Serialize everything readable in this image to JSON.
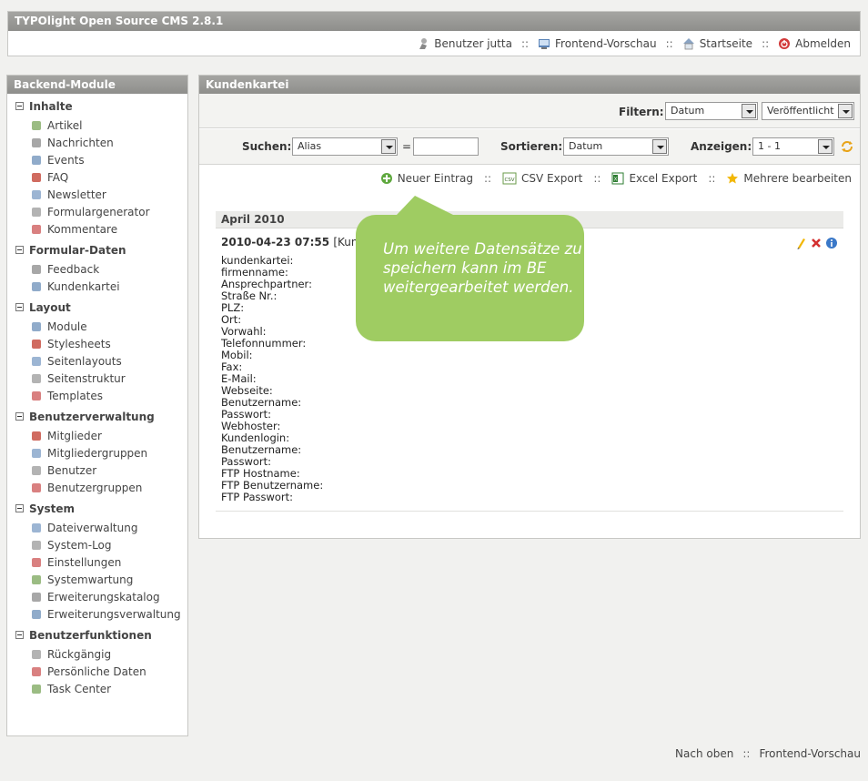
{
  "app": {
    "title": "TYPOlight Open Source CMS 2.8.1"
  },
  "topnav": {
    "user": "Benutzer jutta",
    "preview": "Frontend-Vorschau",
    "home": "Startseite",
    "logout": "Abmelden",
    "sep": "::"
  },
  "sidebar": {
    "title": "Backend-Module",
    "groups": [
      {
        "title": "Inhalte",
        "items": [
          "Artikel",
          "Nachrichten",
          "Events",
          "FAQ",
          "Newsletter",
          "Formulargenerator",
          "Kommentare"
        ]
      },
      {
        "title": "Formular-Daten",
        "items": [
          "Feedback",
          "Kundenkartei"
        ]
      },
      {
        "title": "Layout",
        "items": [
          "Module",
          "Stylesheets",
          "Seitenlayouts",
          "Seitenstruktur",
          "Templates"
        ]
      },
      {
        "title": "Benutzerverwaltung",
        "items": [
          "Mitglieder",
          "Mitgliedergruppen",
          "Benutzer",
          "Benutzergruppen"
        ]
      },
      {
        "title": "System",
        "items": [
          "Dateiverwaltung",
          "System-Log",
          "Einstellungen",
          "Systemwartung",
          "Erweiterungskatalog",
          "Erweiterungsverwaltung"
        ]
      },
      {
        "title": "Benutzerfunktionen",
        "items": [
          "Rückgängig",
          "Persönliche Daten",
          "Task Center"
        ]
      }
    ]
  },
  "main": {
    "title": "Kundenkartei",
    "filter": {
      "label": "Filtern:",
      "field": "Datum",
      "status": "Veröffentlicht"
    },
    "search": {
      "label": "Suchen:",
      "field": "Alias",
      "equals": "=",
      "value": ""
    },
    "sort": {
      "label": "Sortieren:",
      "field": "Datum"
    },
    "show": {
      "label": "Anzeigen:",
      "value": "1 - 1"
    },
    "actions": {
      "new": "Neuer Eintrag",
      "csv": "CSV Export",
      "excel": "Excel Export",
      "multi": "Mehrere bearbeiten",
      "sep": "::"
    },
    "month": "April 2010",
    "record": {
      "date": "2010-04-23 07:55",
      "tail": "[Kun",
      "fields": [
        "kundenkartei:",
        "firmenname:",
        "Ansprechpartner:",
        "Straße Nr.:",
        "PLZ:",
        "Ort:",
        "Vorwahl:",
        "Telefonnummer:",
        "Mobil:",
        "Fax:",
        "E-Mail:",
        "Webseite:",
        "Benutzername:",
        "Passwort:",
        "Webhoster:",
        "Kundenlogin:",
        "Benutzername:",
        "Passwort:",
        "FTP Hostname:",
        "FTP Benutzername:",
        "FTP Passwort:"
      ]
    },
    "callout": "Um weitere Datensätze zu speichern kann im BE weitergearbeitet werden."
  },
  "footer": {
    "top": "Nach oben",
    "preview": "Frontend-Vorschau",
    "sep": "::"
  },
  "colors": {
    "header": "#9a9a97",
    "callout": "#9fcc62",
    "text": "#333333"
  }
}
